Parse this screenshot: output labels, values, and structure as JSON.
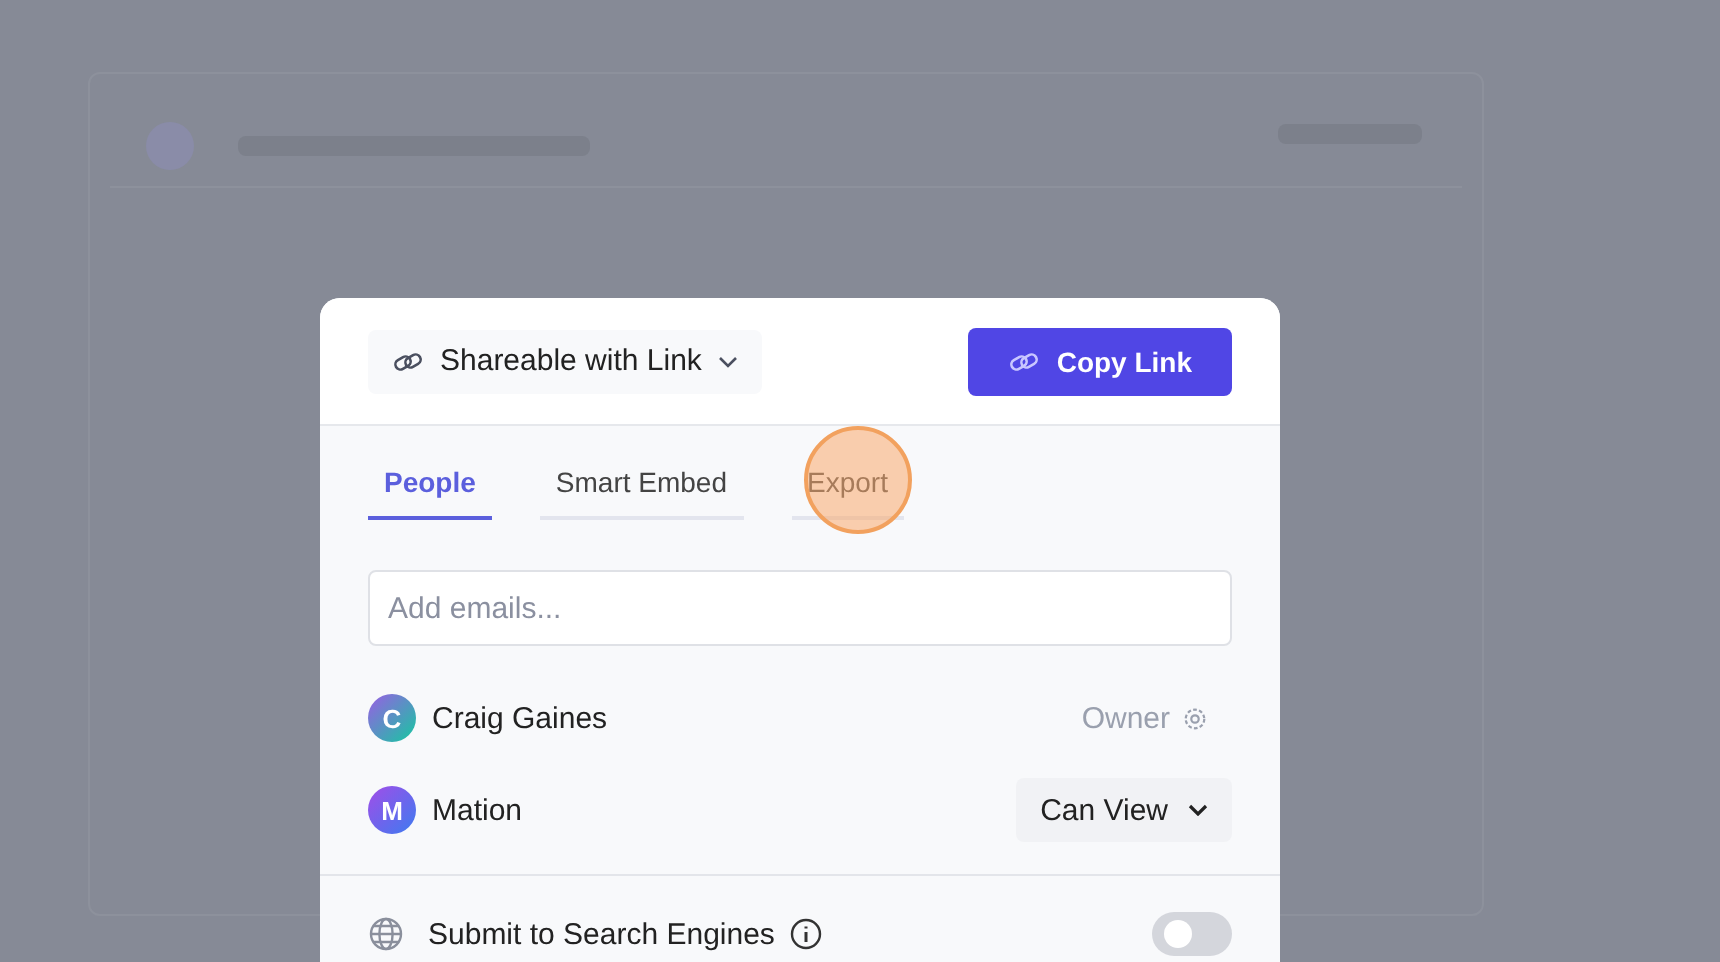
{
  "share_dialog": {
    "visibility": {
      "label": "Shareable with Link"
    },
    "copy_button": {
      "label": "Copy Link"
    },
    "tabs": [
      {
        "label": "People",
        "selected": true
      },
      {
        "label": "Smart Embed",
        "selected": false
      },
      {
        "label": "Export",
        "selected": false
      }
    ],
    "email_field": {
      "placeholder": "Add emails..."
    },
    "people": [
      {
        "initial": "C",
        "name": "Craig Gaines",
        "kind": "owner",
        "role": "Owner"
      },
      {
        "initial": "M",
        "name": "Mation",
        "kind": "member",
        "role": "Can View"
      }
    ],
    "search_engines": {
      "label": "Submit to Search Engines",
      "on": false
    }
  }
}
